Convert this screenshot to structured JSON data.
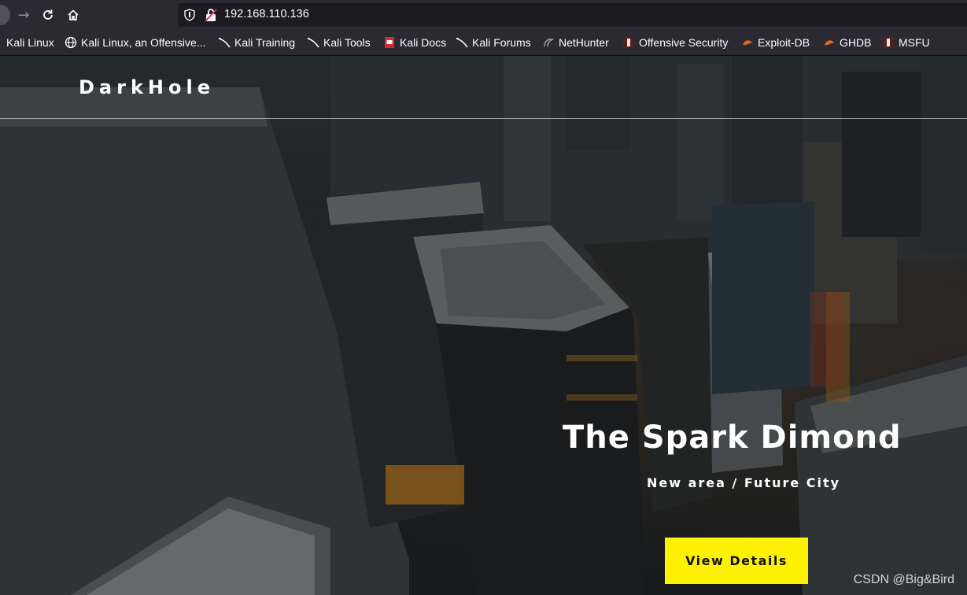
{
  "browser": {
    "url": "192.168.110.136",
    "bookmarks": [
      {
        "label": "Kali Linux",
        "icon": "kali-icon"
      },
      {
        "label": "Kali Linux, an Offensive...",
        "icon": "globe-icon"
      },
      {
        "label": "Kali Training",
        "icon": "kali-dragon-icon"
      },
      {
        "label": "Kali Tools",
        "icon": "kali-dragon-icon"
      },
      {
        "label": "Kali Docs",
        "icon": "kali-docs-icon"
      },
      {
        "label": "Kali Forums",
        "icon": "kali-dragon-icon"
      },
      {
        "label": "NetHunter",
        "icon": "nethunter-icon"
      },
      {
        "label": "Offensive Security",
        "icon": "offsec-icon"
      },
      {
        "label": "Exploit-DB",
        "icon": "exploit-db-icon"
      },
      {
        "label": "GHDB",
        "icon": "exploit-db-icon"
      },
      {
        "label": "MSFU",
        "icon": "offsec-icon"
      }
    ]
  },
  "page": {
    "brand": "DarkHole",
    "hero_title": "The Spark Dimond",
    "hero_subtitle": "New area / Future City",
    "cta_label": "View Details",
    "accent_color": "#fff200"
  },
  "watermark": "CSDN @Big&Bird"
}
